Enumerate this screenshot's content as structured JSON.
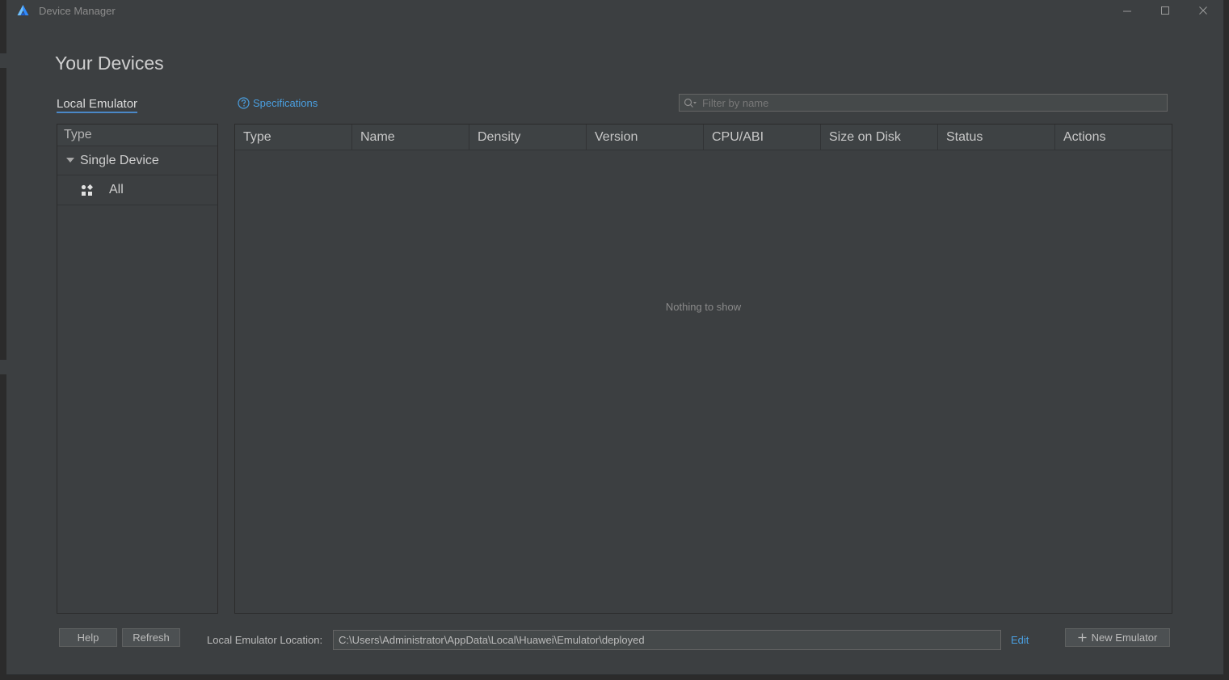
{
  "window": {
    "title": "Device Manager",
    "icon": "app-logo-icon"
  },
  "page": {
    "title": "Your Devices"
  },
  "tabs": {
    "local_emulator": "Local Emulator"
  },
  "specifications": {
    "label": "Specifications",
    "icon": "help-circle-icon"
  },
  "filter": {
    "placeholder": "Filter by name",
    "value": ""
  },
  "type_panel": {
    "header": "Type",
    "group": "Single Device",
    "item": "All"
  },
  "table": {
    "columns": [
      "Type",
      "Name",
      "Density",
      "Version",
      "CPU/ABI",
      "Size on Disk",
      "Status",
      "Actions"
    ],
    "rows": [],
    "empty_message": "Nothing to show"
  },
  "footer": {
    "help_label": "Help",
    "refresh_label": "Refresh",
    "location_label": "Local Emulator Location:",
    "location_value": "C:\\Users\\Administrator\\AppData\\Local\\Huawei\\Emulator\\deployed",
    "edit_label": "Edit",
    "new_emulator_label": "New Emulator"
  },
  "colors": {
    "accent": "#4a9fe0",
    "window_bg": "#3c3f41"
  }
}
